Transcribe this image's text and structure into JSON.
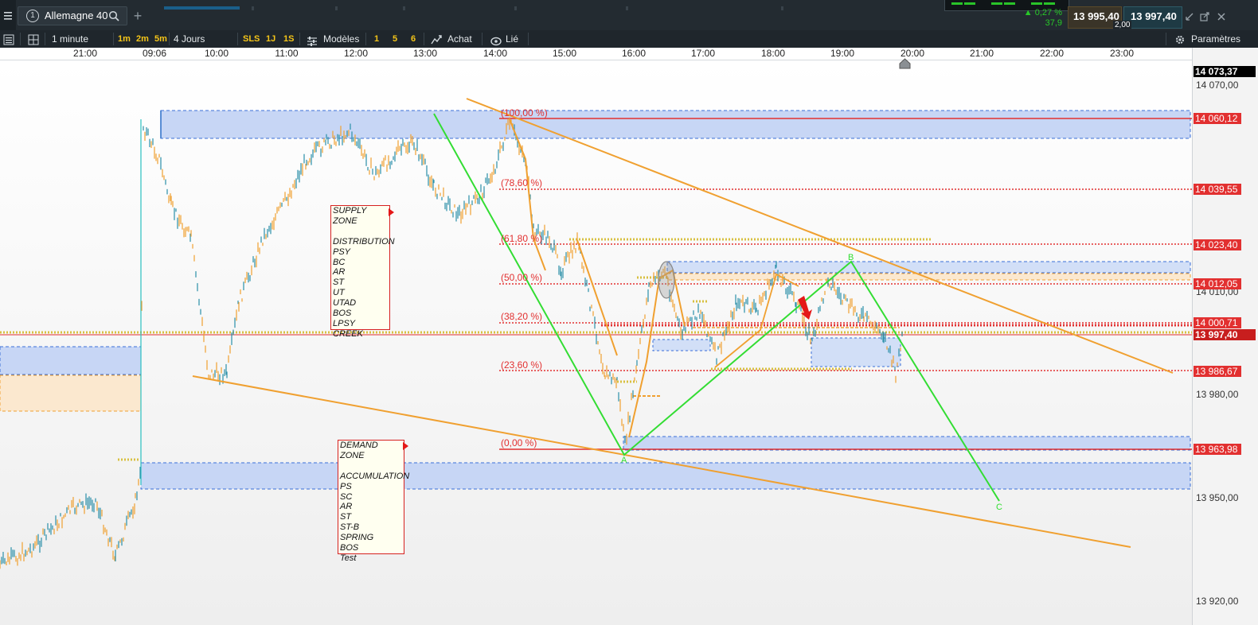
{
  "app": {
    "instrument": "Allemagne 40",
    "window_number": "1",
    "add_tab": "+"
  },
  "quote": {
    "change_pct": "▲ 0,27 %",
    "change_pts": "37,9",
    "bid": "13 995,40",
    "ask": "13 997,40",
    "spread": "2,00"
  },
  "toolbar": {
    "interval": "1 minute",
    "btn_1m": "1m",
    "btn_2m": "2m",
    "btn_5m": "5m",
    "period": "4 Jours",
    "btn_sls": "SLS",
    "btn_1j": "1J",
    "btn_1s": "1S",
    "models": "Modèles",
    "btn_1": "1",
    "btn_5": "5",
    "btn_6": "6",
    "buy": "Achat",
    "linked": "Lié",
    "settings": "Paramètres"
  },
  "time_axis": [
    "21:00",
    "09:06",
    "10:00",
    "11:00",
    "12:00",
    "13:00",
    "14:00",
    "15:00",
    "16:00",
    "17:00",
    "18:00",
    "19:00",
    "20:00",
    "21:00",
    "22:00",
    "23:00"
  ],
  "price_axis": {
    "labels": [
      "14 070,00",
      "14 010,00",
      "13 980,00",
      "13 950,00",
      "13 920,00"
    ],
    "tags": [
      {
        "text": "14 073,37",
        "color": "#000000"
      },
      {
        "text": "14 060,12",
        "color": "#e23030"
      },
      {
        "text": "14 039,55",
        "color": "#e23030"
      },
      {
        "text": "14 023,40",
        "color": "#e23030"
      },
      {
        "text": "14 012,05",
        "color": "#e23030"
      },
      {
        "text": "14 000,71",
        "color": "#e23030"
      },
      {
        "text": "13 997,40",
        "color": "#c81e1e"
      },
      {
        "text": "13 986,67",
        "color": "#e23030"
      },
      {
        "text": "13 963,98",
        "color": "#e23030"
      }
    ]
  },
  "fibonacci": [
    "(100,00 %)",
    "(78,60 %)",
    "(61,80 %)",
    "(50,00 %)",
    "(38,20 %)",
    "(23,60 %)",
    "(0,00 %)"
  ],
  "supply_zone": {
    "title": "SUPPLY ZONE",
    "items": [
      "DISTRIBUTION",
      "PSY",
      "BC",
      "AR",
      "ST",
      "UT",
      "UTAD",
      "BOS",
      "LPSY",
      "CREEK"
    ]
  },
  "demand_zone": {
    "title": "DEMAND ZONE",
    "items": [
      "ACCUMULATION",
      "PS",
      "SC",
      "AR",
      "ST",
      "ST-B",
      "SPRING",
      "BOS",
      "Test"
    ]
  },
  "wave_labels": {
    "a": "A",
    "b": "B",
    "c": "C"
  },
  "colors": {
    "bull": "#2a8fa8",
    "bear": "#f0a030",
    "fib": "#e23030",
    "trend": "#f0a030",
    "wave": "#33dd33",
    "zone_blue": "#c7d6f5",
    "zone_orange": "#fbe8cf"
  }
}
